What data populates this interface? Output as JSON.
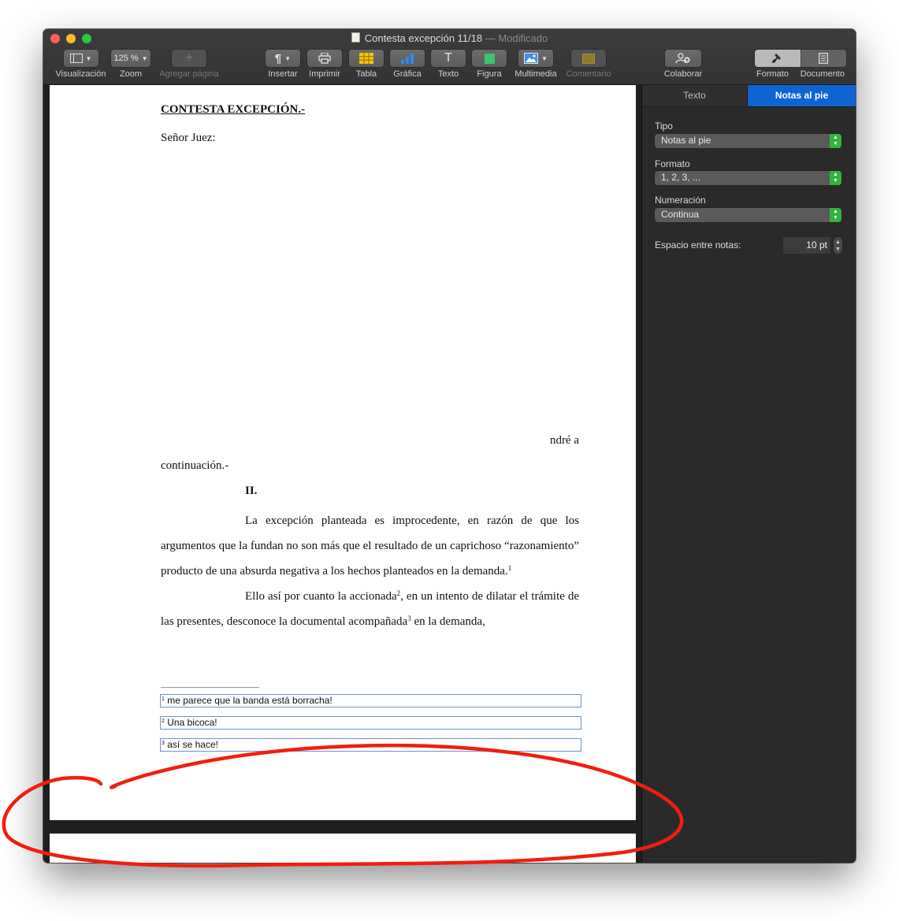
{
  "window": {
    "title": "Contesta excepción 11/18",
    "title_suffix": "— Modificado"
  },
  "toolbar": {
    "view_label": "Visualización",
    "zoom_value": "125 %",
    "zoom_label": "Zoom",
    "add_page_label": "Agregar página",
    "insert_label": "Insertar",
    "print_label": "Imprimir",
    "table_label": "Tabla",
    "chart_label": "Gráfica",
    "text_label": "Texto",
    "shape_label": "Figura",
    "media_label": "Multimedia",
    "comment_label": "Comentario",
    "collaborate_label": "Colaborar",
    "format_label": "Formato",
    "document_label": "Documento",
    "insert_glyph": "¶",
    "text_glyph": "T",
    "add_glyph": "+"
  },
  "document": {
    "heading": "CONTESTA EXCEPCIÓN.-",
    "salutation": "Señor Juez:",
    "fragment": "ndré a",
    "continuation": "continuación.-",
    "section": "II.",
    "p1": "La excepción planteada es improcedente, en razón de que los argumentos que la fundan no son más que el resultado de un caprichoso “razonamiento” producto de una absurda negativa a los hechos planteados en la demanda.",
    "p1_ref": "1",
    "p2_a": "Ello así por cuanto la accionada",
    "p2_ref1": "2",
    "p2_b": ", en un intento de dilatar el trámite de las presentes, desconoce la documental acompañada",
    "p2_ref2": "3",
    "p2_c": " en la demanda,",
    "footnotes": [
      {
        "num": "1",
        "text": "me parece que la banda está borracha!"
      },
      {
        "num": "2",
        "text": "Una bicoca!"
      },
      {
        "num": "3",
        "text": "así se hace!"
      }
    ]
  },
  "inspector": {
    "tab_text": "Texto",
    "tab_footnotes": "Notas al pie",
    "type_label": "Tipo",
    "type_value": "Notas al pie",
    "format_label": "Formato",
    "format_value": "1, 2, 3, ...",
    "numbering_label": "Numeración",
    "numbering_value": "Continua",
    "spacing_label": "Espacio entre notas:",
    "spacing_value": "10 pt"
  },
  "colors": {
    "accent": "#0e64d2",
    "stepper_green": "#2fb43c",
    "annotation_red": "#f21d0f",
    "footnote_border": "#6d8fd6"
  }
}
